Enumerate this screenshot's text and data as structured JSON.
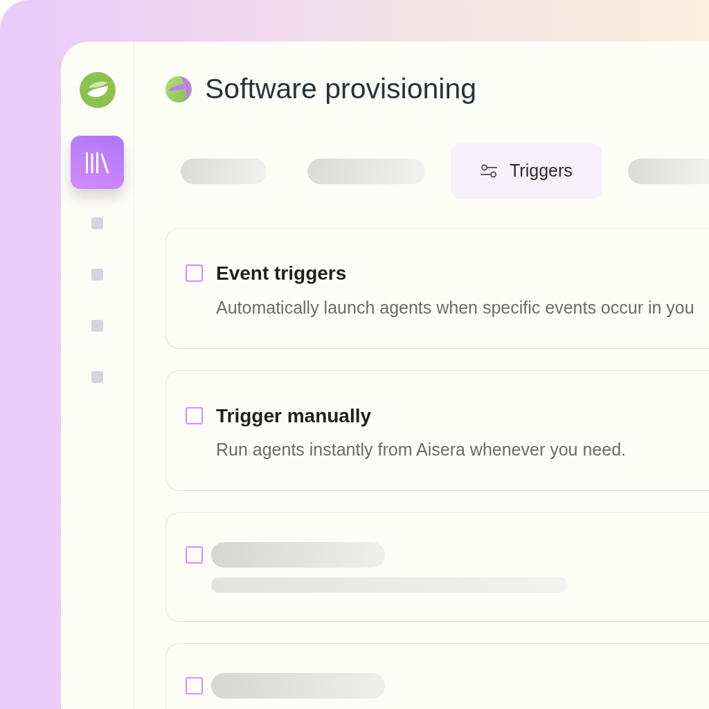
{
  "sidebar": {
    "items": [
      {
        "kind": "library",
        "selected": true
      },
      {
        "kind": "placeholder",
        "selected": false
      },
      {
        "kind": "placeholder",
        "selected": false
      },
      {
        "kind": "placeholder",
        "selected": false
      },
      {
        "kind": "placeholder",
        "selected": false
      }
    ]
  },
  "header": {
    "title": "Software provisioning"
  },
  "tabs": [
    {
      "kind": "placeholder",
      "selected": false
    },
    {
      "kind": "placeholder",
      "selected": false
    },
    {
      "kind": "tab",
      "label": "Triggers",
      "selected": true
    },
    {
      "kind": "placeholder",
      "selected": false
    }
  ],
  "options": [
    {
      "kind": "option",
      "title": "Event triggers",
      "description": "Automatically launch agents when specific events occur in you",
      "checked": false
    },
    {
      "kind": "option",
      "title": "Trigger manually",
      "description": "Run agents instantly from Aisera whenever you need.",
      "checked": false
    },
    {
      "kind": "placeholder",
      "checked": false
    },
    {
      "kind": "placeholder",
      "checked": false
    }
  ]
}
